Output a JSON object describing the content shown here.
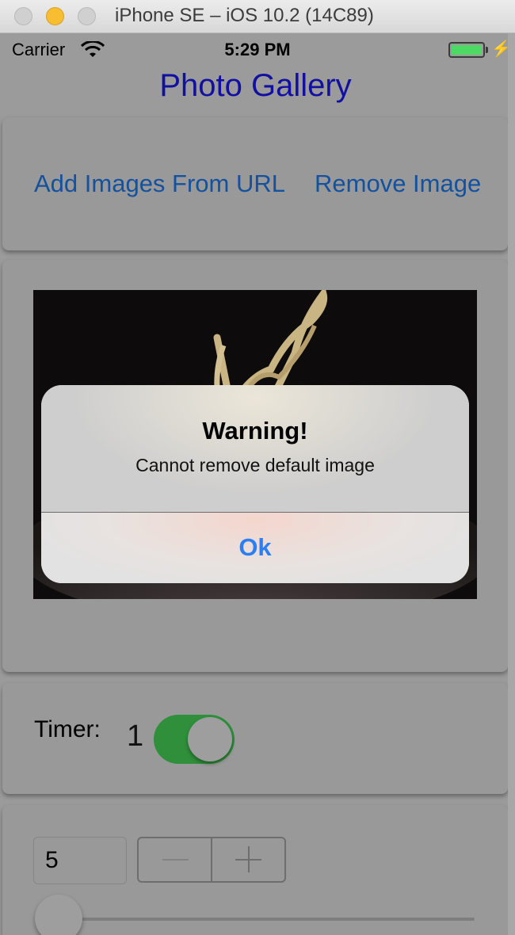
{
  "window": {
    "title": "iPhone SE – iOS 10.2 (14C89)"
  },
  "status_bar": {
    "carrier": "Carrier",
    "time": "5:29 PM",
    "battery_color": "#4cd964"
  },
  "nav": {
    "title": "Photo Gallery",
    "title_color": "#1110a0"
  },
  "actions": {
    "add_label": "Add Images From URL",
    "remove_label": "Remove Image",
    "link_color": "#14519e"
  },
  "timer": {
    "label": "Timer:",
    "value": "1",
    "toggle_on": true,
    "toggle_color": "#2f8f3b"
  },
  "interval": {
    "value": "5",
    "slider_value": 0
  },
  "alert": {
    "title": "Warning!",
    "message": "Cannot remove default image",
    "button_label": "Ok",
    "button_color": "#2b7ef3"
  },
  "icons": [
    "wifi-icon",
    "charging-bolt-icon",
    "minus-icon",
    "plus-icon"
  ]
}
